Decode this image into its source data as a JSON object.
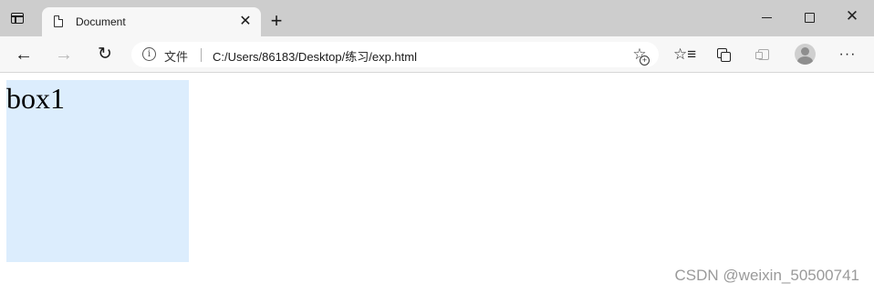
{
  "tab": {
    "title": "Document",
    "close_glyph": "✕"
  },
  "new_tab_glyph": "+",
  "window": {
    "close_glyph": "✕"
  },
  "toolbar": {
    "back_glyph": "←",
    "forward_glyph": "→",
    "refresh_glyph": "↻",
    "more_glyph": "···",
    "favorites_glyph": "☆≡"
  },
  "address": {
    "info_glyph": "i",
    "scheme_label": "文件",
    "url": "C:/Users/86183/Desktop/练习/exp.html",
    "fav_glyph": "☆"
  },
  "page": {
    "box1_text": "box1",
    "box1_color": "#dcedfd"
  },
  "watermark": "CSDN @weixin_50500741"
}
